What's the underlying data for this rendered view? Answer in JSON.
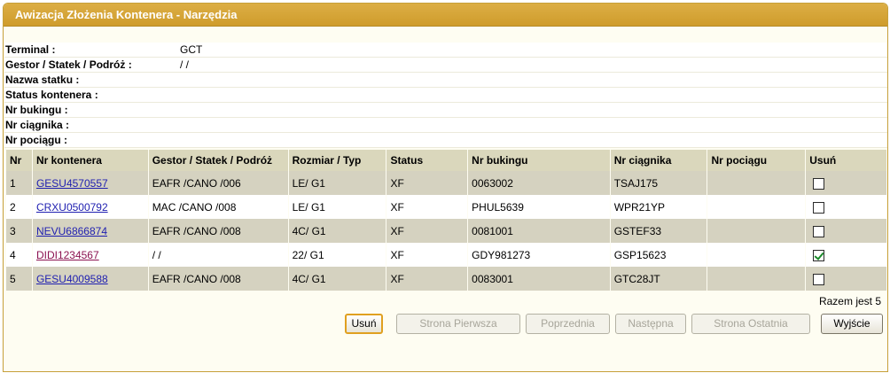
{
  "window": {
    "title": "Awizacja Złożenia Kontenera - Narzędzia"
  },
  "info": [
    {
      "label": "Terminal :",
      "value": "GCT"
    },
    {
      "label": "Gestor / Statek / Podróż :",
      "value": "/ /"
    },
    {
      "label": "Nazwa statku :",
      "value": ""
    },
    {
      "label": "Status kontenera :",
      "value": ""
    },
    {
      "label": "Nr bukingu :",
      "value": ""
    },
    {
      "label": "Nr ciągnika :",
      "value": ""
    },
    {
      "label": "Nr pociągu :",
      "value": ""
    }
  ],
  "table": {
    "headers": [
      "Nr",
      "Nr kontenera",
      "Gestor / Statek / Podróż",
      "Rozmiar / Typ",
      "Status",
      "Nr bukingu",
      "Nr ciągnika",
      "Nr pociągu",
      "Usuń"
    ],
    "rows": [
      {
        "nr": "1",
        "kontener": "GESU4570557",
        "gestor": "EAFR /CANO /006",
        "rozmiar": "LE/ G1",
        "status": "XF",
        "buking": "0063002",
        "ciagnik": "TSAJ175",
        "pociag": "",
        "checked": false
      },
      {
        "nr": "2",
        "kontener": "CRXU0500792",
        "gestor": "MAC /CANO /008",
        "rozmiar": "LE/ G1",
        "status": "XF",
        "buking": "PHUL5639",
        "ciagnik": "WPR21YP",
        "pociag": "",
        "checked": false
      },
      {
        "nr": "3",
        "kontener": "NEVU6866874",
        "gestor": "EAFR /CANO /008",
        "rozmiar": "4C/ G1",
        "status": "XF",
        "buking": "0081001",
        "ciagnik": "GSTEF33",
        "pociag": "",
        "checked": false
      },
      {
        "nr": "4",
        "kontener": "DIDI1234567",
        "gestor": "/ /",
        "rozmiar": "22/ G1",
        "status": "XF",
        "buking": "GDY981273",
        "ciagnik": "GSP15623",
        "pociag": "",
        "checked": true
      },
      {
        "nr": "5",
        "kontener": "GESU4009588",
        "gestor": "EAFR /CANO /008",
        "rozmiar": "4C/ G1",
        "status": "XF",
        "buking": "0083001",
        "ciagnik": "GTC28JT",
        "pociag": "",
        "checked": false
      }
    ]
  },
  "footer": {
    "total": "Razem jest 5",
    "buttons": {
      "delete": "Usuń",
      "first": "Strona Pierwsza",
      "prev": "Poprzednia",
      "next": "Następna",
      "last": "Strona Ostatnia",
      "exit": "Wyjście"
    }
  },
  "colors": {
    "title_bar": "#d4a233",
    "header_bg": "#dad7bc",
    "row_alt": "#d5d2c0",
    "link": "#1f1fb0",
    "visited_link": "#8b1250"
  }
}
